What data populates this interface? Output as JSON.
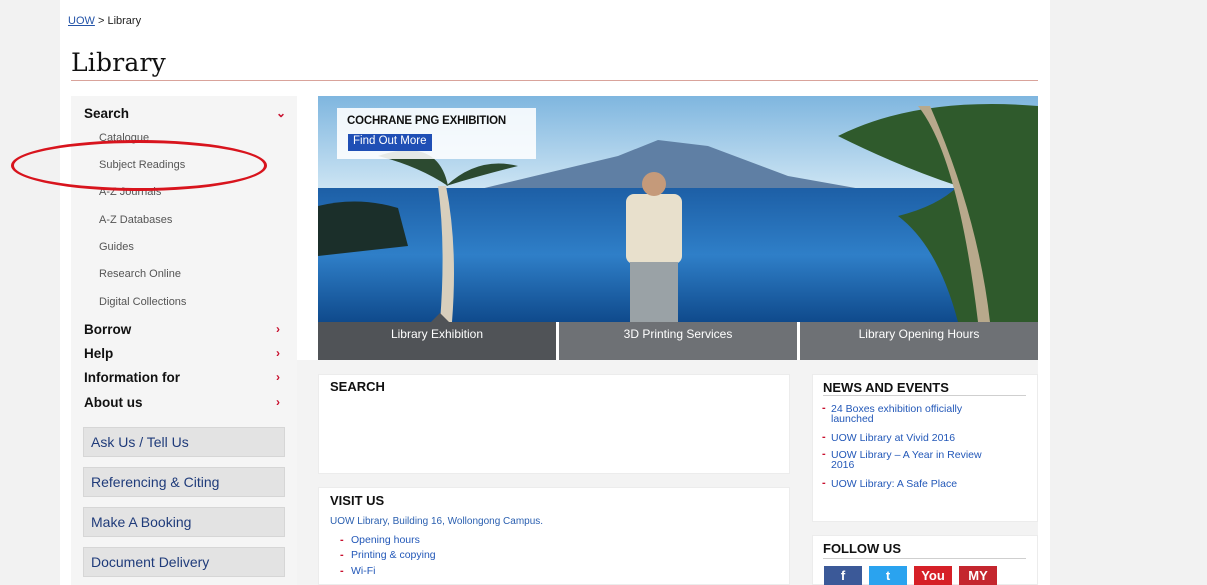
{
  "breadcrumb": {
    "link": "UOW",
    "sep": ">",
    "current": "Library"
  },
  "page_title": "Library",
  "sidebar": {
    "search": {
      "label": "Search",
      "arrow": "⌄"
    },
    "sub_items": [
      "Catalogue",
      "Subject Readings",
      "A-Z Journals",
      "A-Z Databases",
      "Guides",
      "Research Online",
      "Digital Collections"
    ],
    "main_items": [
      {
        "label": "Borrow",
        "arrow": "›"
      },
      {
        "label": "Help",
        "arrow": "›"
      },
      {
        "label": "Information for",
        "arrow": "›"
      },
      {
        "label": "About us",
        "arrow": "›"
      }
    ],
    "buttons": [
      "Ask Us / Tell Us",
      "Referencing & Citing",
      "Make A Booking",
      "Document Delivery"
    ]
  },
  "hero": {
    "title": "COCHRANE PNG EXHIBITION",
    "button": "Find Out More",
    "tabs": [
      "Library Exhibition",
      "3D Printing Services",
      "Library Opening Hours"
    ]
  },
  "search_panel": {
    "title": "SEARCH"
  },
  "visit_panel": {
    "title": "VISIT US",
    "subtitle": "UOW Library, Building 16, Wollongong Campus.",
    "items": [
      "Opening hours",
      "Printing & copying",
      "Wi-Fi"
    ]
  },
  "news_panel": {
    "title": "NEWS AND EVENTS",
    "items": [
      {
        "line1": "24 Boxes exhibition officially",
        "line2": "launched"
      },
      {
        "line1": "UOW Library at Vivid 2016",
        "line2": ""
      },
      {
        "line1": "UOW Library – A Year in Review",
        "line2": "2016"
      },
      {
        "line1": "UOW Library: A Safe Place",
        "line2": ""
      }
    ]
  },
  "follow_panel": {
    "title": "FOLLOW US",
    "icons": [
      {
        "name": "facebook-icon",
        "glyph": "f",
        "color": "#3b5998"
      },
      {
        "name": "twitter-icon",
        "glyph": "t",
        "color": "#2aa3ef"
      },
      {
        "name": "youtube-icon",
        "glyph": "You",
        "color": "#d62027"
      },
      {
        "name": "myspace-icon",
        "glyph": "MY",
        "color": "#c4262e"
      }
    ]
  },
  "colors": {
    "accent_red": "#c8102e",
    "link_blue": "#2454a8",
    "button_blue": "#1f4fb5",
    "tab_grey": "#6e7175",
    "annotation_red": "#d8141d"
  }
}
